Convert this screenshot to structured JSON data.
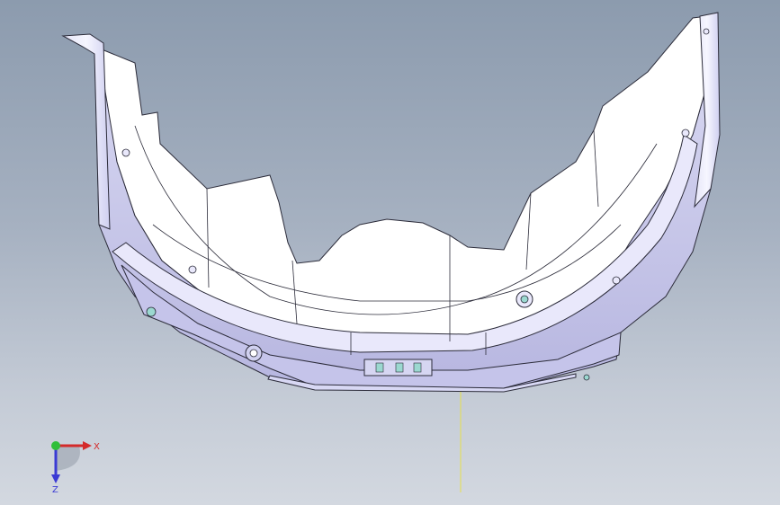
{
  "viewport": {
    "background_top": "#8c9bae",
    "background_bottom": "#d3d8e0",
    "part_face_color": "#ffffff",
    "part_shade_color": "#c7c6ea",
    "edge_color": "#2c2c3a",
    "ruler_color": "#e6e04a"
  },
  "triad": {
    "x_label": "X",
    "z_label": "Z",
    "x_color": "#d42a2a",
    "y_color": "#2fbf3a",
    "z_color": "#3a3ad4"
  }
}
